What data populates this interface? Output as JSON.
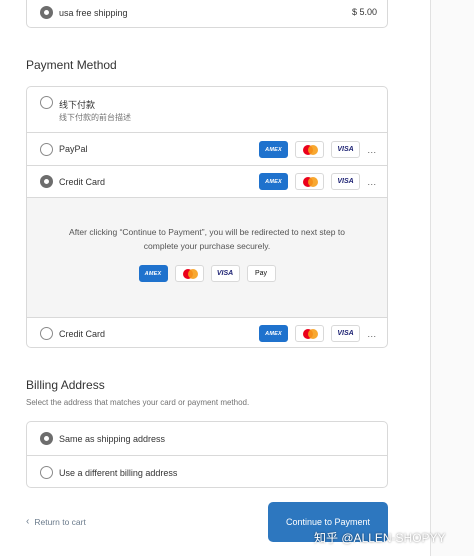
{
  "shipping": {
    "option_label": "usa free shipping",
    "price": "$ 5.00"
  },
  "payment": {
    "heading": "Payment Method",
    "methods": [
      {
        "label": "线下付款",
        "description": "线下付款的前台描述"
      },
      {
        "label": "PayPal"
      },
      {
        "label": "Credit Card"
      },
      {
        "label": "Credit Card"
      }
    ],
    "redirect_text": "After clicking “Continue to Payment”, you will be redirected to next step to complete your purchase securely.",
    "card_icons": {
      "amex": "AMEX",
      "visa": "VISA",
      "apple_pay": " Pay",
      "more": "..."
    }
  },
  "billing": {
    "heading": "Billing Address",
    "description": "Select the address that matches your card or payment method.",
    "options": [
      "Same as shipping address",
      "Use a different billing address"
    ]
  },
  "footer": {
    "back_label": "Return to cart",
    "continue_label": "Continue to Payment"
  },
  "watermark": "知乎 @ALLEN-SHOPYY",
  "colors": {
    "primary_button": "#2d77bf",
    "amex": "#1f72cd",
    "mastercard_red": "#eb001b",
    "mastercard_orange": "#f79e1b",
    "visa_blue": "#1a1f71"
  }
}
